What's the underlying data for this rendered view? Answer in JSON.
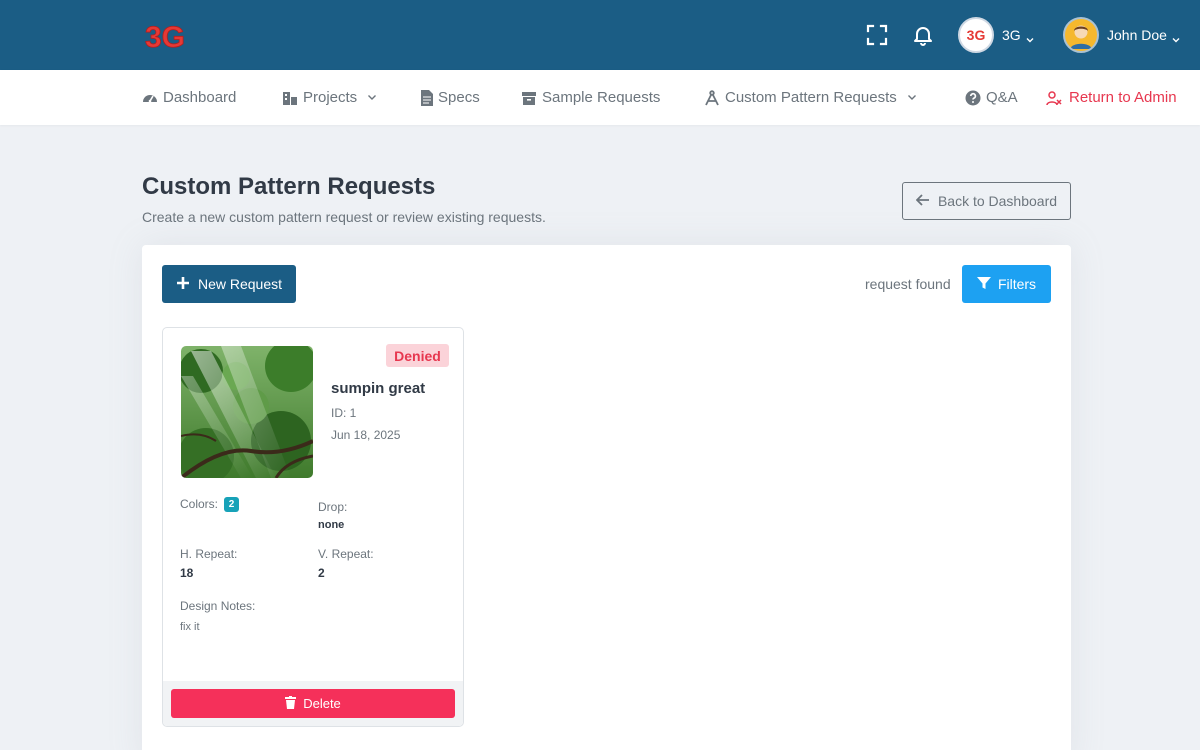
{
  "colors": {
    "topbar": "#1b5d85",
    "accent_red": "#e7374f",
    "filter_blue": "#1da1f2",
    "delete_red": "#f5305a",
    "badge_teal": "#17a2b8"
  },
  "header": {
    "logo_text": "3G",
    "fullscreen_icon": "fullscreen-icon",
    "bell_icon": "bell-icon",
    "brand": {
      "avatar_text": "3G",
      "label": "3G"
    },
    "user": {
      "name": "John Doe"
    }
  },
  "nav": {
    "items": [
      {
        "label": "Dashboard",
        "icon": "dashboard-icon"
      },
      {
        "label": "Projects",
        "icon": "projects-icon",
        "dropdown": true
      },
      {
        "label": "Specs",
        "icon": "document-icon"
      },
      {
        "label": "Sample Requests",
        "icon": "archive-icon"
      },
      {
        "label": "Custom Pattern Requests",
        "icon": "compass-icon",
        "dropdown": true
      },
      {
        "label": "Q&A",
        "icon": "question-icon"
      },
      {
        "label": "Return to Admin",
        "icon": "user-x-icon"
      }
    ]
  },
  "page": {
    "title": "Custom Pattern Requests",
    "subtitle": "Create a new custom pattern request or review existing requests.",
    "back_label": "Back to Dashboard"
  },
  "toolbar": {
    "new_label": "New Request",
    "found_text": "request found",
    "filters_label": "Filters"
  },
  "requests": [
    {
      "status": "Denied",
      "name": "sumpin great",
      "id_text": "ID: 1",
      "date": "Jun 18, 2025",
      "colors_label": "Colors:",
      "colors_count": "2",
      "drop_label": "Drop:",
      "drop_value": "none",
      "h_repeat_label": "H. Repeat:",
      "h_repeat_value": "18",
      "v_repeat_label": "V. Repeat:",
      "v_repeat_value": "2",
      "notes_label": "Design Notes:",
      "notes_value": "fix it",
      "delete_label": "Delete"
    }
  ]
}
